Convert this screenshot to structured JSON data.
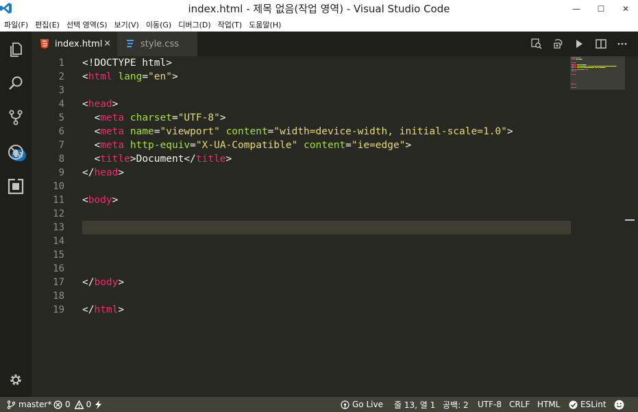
{
  "window": {
    "title": "index.html - 제목 없음(작업 영역) - Visual Studio Code",
    "minimize": "—",
    "maximize": "☐",
    "close": "✕"
  },
  "menu": [
    "파일(F)",
    "편집(E)",
    "선택 영역(S)",
    "보기(V)",
    "이동(G)",
    "디버그(D)",
    "작업(T)",
    "도움말(H)"
  ],
  "activity": {
    "scm_badge": "21"
  },
  "tabs": [
    {
      "label": "index.html",
      "close": "×",
      "active": true
    },
    {
      "label": "style.css",
      "active": false
    }
  ],
  "editor": {
    "line_numbers": [
      "1",
      "2",
      "3",
      "4",
      "5",
      "6",
      "7",
      "8",
      "9",
      "10",
      "11",
      "12",
      "13",
      "14",
      "15",
      "16",
      "17",
      "18",
      "19"
    ],
    "lines": [
      [
        {
          "c": "pn",
          "t": "<!DOCTYPE html>"
        }
      ],
      [
        {
          "c": "pn",
          "t": "<"
        },
        {
          "c": "tg",
          "t": "html"
        },
        {
          "c": "pn",
          "t": " "
        },
        {
          "c": "at",
          "t": "lang"
        },
        {
          "c": "pn",
          "t": "="
        },
        {
          "c": "st",
          "t": "\"en\""
        },
        {
          "c": "pn",
          "t": ">"
        }
      ],
      [],
      [
        {
          "c": "pn",
          "t": "<"
        },
        {
          "c": "tg",
          "t": "head"
        },
        {
          "c": "pn",
          "t": ">"
        }
      ],
      [
        {
          "c": "pn",
          "t": "  <"
        },
        {
          "c": "tg",
          "t": "meta"
        },
        {
          "c": "pn",
          "t": " "
        },
        {
          "c": "at",
          "t": "charset"
        },
        {
          "c": "pn",
          "t": "="
        },
        {
          "c": "st",
          "t": "\"UTF-8\""
        },
        {
          "c": "pn",
          "t": ">"
        }
      ],
      [
        {
          "c": "pn",
          "t": "  <"
        },
        {
          "c": "tg",
          "t": "meta"
        },
        {
          "c": "pn",
          "t": " "
        },
        {
          "c": "at",
          "t": "name"
        },
        {
          "c": "pn",
          "t": "="
        },
        {
          "c": "st",
          "t": "\"viewport\""
        },
        {
          "c": "pn",
          "t": " "
        },
        {
          "c": "at",
          "t": "content"
        },
        {
          "c": "pn",
          "t": "="
        },
        {
          "c": "st",
          "t": "\"width=device-width, initial-scale=1.0\""
        },
        {
          "c": "pn",
          "t": ">"
        }
      ],
      [
        {
          "c": "pn",
          "t": "  <"
        },
        {
          "c": "tg",
          "t": "meta"
        },
        {
          "c": "pn",
          "t": " "
        },
        {
          "c": "at",
          "t": "http-equiv"
        },
        {
          "c": "pn",
          "t": "="
        },
        {
          "c": "st",
          "t": "\"X-UA-Compatible\""
        },
        {
          "c": "pn",
          "t": " "
        },
        {
          "c": "at",
          "t": "content"
        },
        {
          "c": "pn",
          "t": "="
        },
        {
          "c": "st",
          "t": "\"ie=edge\""
        },
        {
          "c": "pn",
          "t": ">"
        }
      ],
      [
        {
          "c": "pn",
          "t": "  <"
        },
        {
          "c": "tg",
          "t": "title"
        },
        {
          "c": "pn",
          "t": ">Document</"
        },
        {
          "c": "tg",
          "t": "title"
        },
        {
          "c": "pn",
          "t": ">"
        }
      ],
      [
        {
          "c": "pn",
          "t": "</"
        },
        {
          "c": "tg",
          "t": "head"
        },
        {
          "c": "pn",
          "t": ">"
        }
      ],
      [],
      [
        {
          "c": "pn",
          "t": "<"
        },
        {
          "c": "tg",
          "t": "body"
        },
        {
          "c": "pn",
          "t": ">"
        }
      ],
      [],
      [],
      [],
      [],
      [],
      [
        {
          "c": "pn",
          "t": "</"
        },
        {
          "c": "tg",
          "t": "body"
        },
        {
          "c": "pn",
          "t": ">"
        }
      ],
      [],
      [
        {
          "c": "pn",
          "t": "</"
        },
        {
          "c": "tg",
          "t": "html"
        },
        {
          "c": "pn",
          "t": ">"
        }
      ]
    ],
    "current_line": 13
  },
  "status": {
    "branch": "master*",
    "errors": "0",
    "warnings": "0",
    "golive": "Go Live",
    "position": "줄 13, 열 1",
    "spaces": "공백: 2",
    "encoding": "UTF-8",
    "eol": "CRLF",
    "language": "HTML",
    "eslint": "ESLint"
  },
  "colors": {
    "editor_bg": "#272822",
    "tag": "#f92672",
    "attr": "#a6e22e",
    "string": "#e6db74",
    "statusbar": "#414339",
    "badge": "#0e70c0"
  }
}
